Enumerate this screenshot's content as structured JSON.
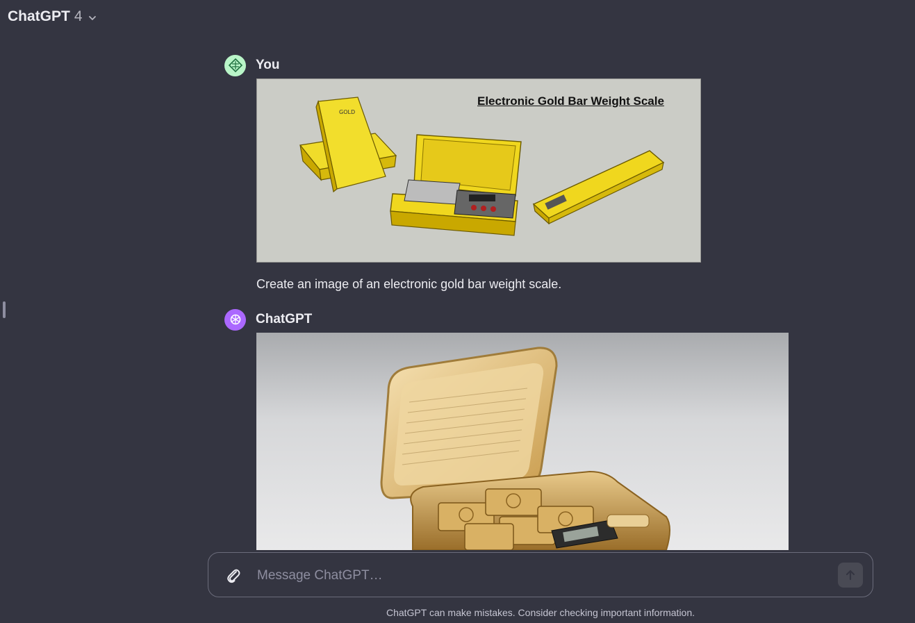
{
  "header": {
    "title": "ChatGPT",
    "version": "4"
  },
  "messages": [
    {
      "author": "You",
      "image_caption": "Electronic Gold Bar Weight Scale",
      "text": "Create an image of an electronic gold bar weight scale."
    },
    {
      "author": "ChatGPT"
    }
  ],
  "composer": {
    "placeholder": "Message ChatGPT…"
  },
  "footer": {
    "disclaimer": "ChatGPT can make mistakes. Consider checking important information."
  },
  "colors": {
    "background": "#343541",
    "user_avatar": "#b9f5c8",
    "bot_avatar": "#ab68ff",
    "gold": "#e6c91a"
  }
}
